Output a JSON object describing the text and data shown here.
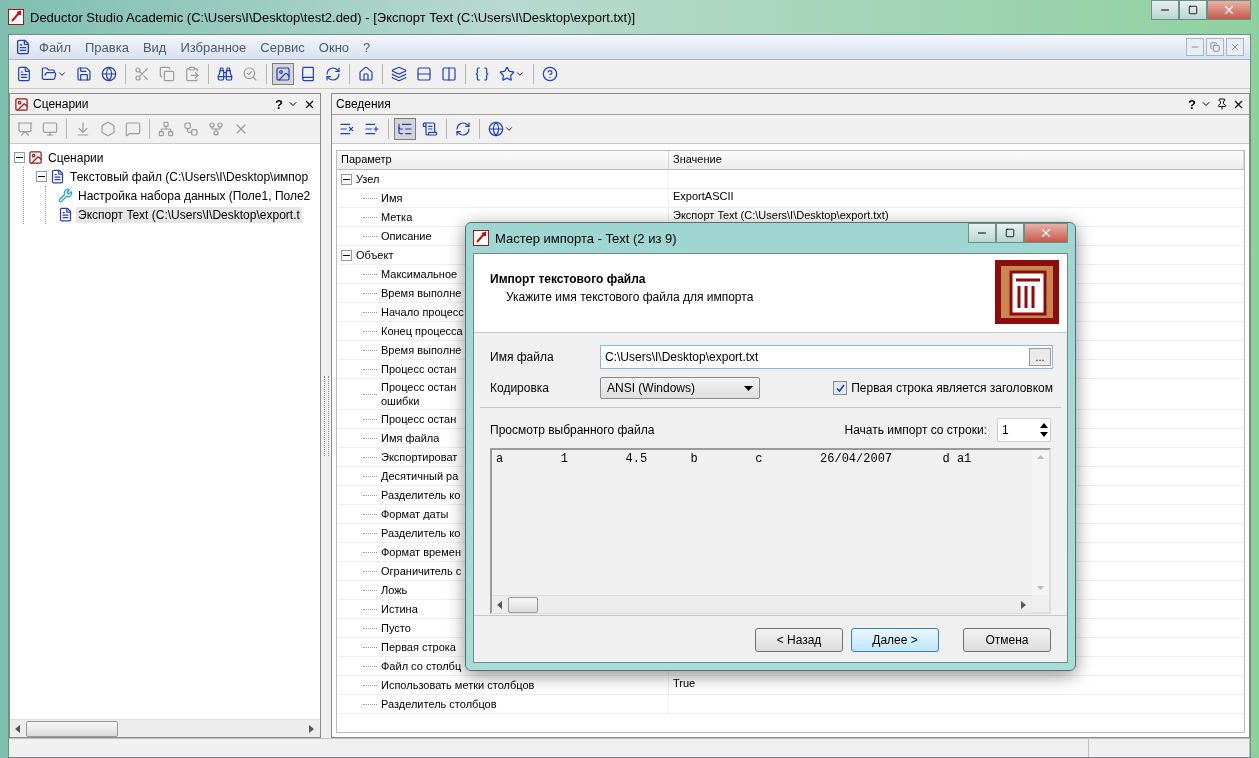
{
  "window": {
    "title": "Deductor Studio Academic (C:\\Users\\I\\Desktop\\test2.ded) - [Экспорт Text (C:\\Users\\I\\Desktop\\export.txt)]"
  },
  "menu": [
    "Файл",
    "Правка",
    "Вид",
    "Избранное",
    "Сервис",
    "Окно",
    "?"
  ],
  "toolbar": [
    {
      "pressed": false,
      "disabled": false
    },
    {
      "pressed": false,
      "disabled": false
    },
    {
      "pressed": false,
      "disabled": false
    },
    {
      "pressed": false,
      "disabled": false
    },
    {
      "pressed": false,
      "disabled": true
    },
    {
      "pressed": false,
      "disabled": true
    },
    {
      "pressed": false,
      "disabled": true
    },
    {
      "pressed": false,
      "disabled": false
    },
    {
      "pressed": false,
      "disabled": true
    },
    {
      "pressed": true,
      "disabled": false
    },
    {
      "pressed": false,
      "disabled": false
    },
    {
      "pressed": false,
      "disabled": false
    },
    {
      "pressed": false,
      "disabled": false
    },
    {
      "pressed": false,
      "disabled": false
    },
    {
      "pressed": false,
      "disabled": false
    },
    {
      "pressed": false,
      "disabled": false
    },
    {
      "pressed": false,
      "disabled": false
    },
    {
      "pressed": false,
      "disabled": false
    },
    {
      "pressed": false,
      "disabled": false
    }
  ],
  "scenarios_panel": {
    "title": "Сценарии",
    "help": "?",
    "toolbar": [
      {
        "disabled": true
      },
      {
        "disabled": true
      },
      {
        "disabled": true
      },
      {
        "disabled": true
      },
      {
        "disabled": true
      },
      {
        "disabled": true
      },
      {
        "disabled": true
      },
      {
        "disabled": true
      },
      {
        "disabled": true
      }
    ],
    "tree": [
      {
        "label": "Сценарии",
        "expanded": true,
        "selected": false,
        "children": [
          {
            "label": "Текстовый файл (C:\\Users\\I\\Desktop\\импор",
            "expanded": true,
            "selected": false,
            "children": [
              {
                "label": "Настройка набора данных (Поле1, Поле2",
                "selected": false
              },
              {
                "label": "Экспорт Text (C:\\Users\\I\\Desktop\\export.t",
                "selected": true
              }
            ]
          }
        ]
      }
    ]
  },
  "info_panel": {
    "title": "Сведения",
    "help": "?",
    "toolbar": [
      {
        "pressed": false
      },
      {
        "pressed": false
      },
      {
        "pressed": true
      },
      {
        "pressed": false
      },
      {
        "pressed": false
      },
      {
        "pressed": false
      }
    ],
    "columns": [
      "Параметр",
      "Значение"
    ],
    "groups": [
      {
        "label": "Узел",
        "expanded": true,
        "rows": [
          {
            "name": "Имя",
            "value": "ExportASCII"
          },
          {
            "name": "Метка",
            "value": "Экспорт Text (C:\\Users\\I\\Desktop\\export.txt)"
          },
          {
            "name": "Описание"
          }
        ]
      },
      {
        "label": "Объект",
        "expanded": true,
        "rows": [
          {
            "name": "Максимальное"
          },
          {
            "name": "Время выполне"
          },
          {
            "name": "Начало процесс"
          },
          {
            "name": "Конец процесса"
          },
          {
            "name": "Время выполне"
          },
          {
            "name": "Процесс остан"
          },
          {
            "name": "Процесс остан\nошибки"
          },
          {
            "name": "Процесс остан"
          },
          {
            "name": "Имя файла"
          },
          {
            "name": "Экспортироват"
          },
          {
            "name": "Десятичный ра"
          },
          {
            "name": "Разделитель ко"
          },
          {
            "name": "Формат даты"
          },
          {
            "name": "Разделитель ко"
          },
          {
            "name": "Формат времен"
          },
          {
            "name": "Ограничитель с"
          },
          {
            "name": "Ложь"
          },
          {
            "name": "Истина"
          },
          {
            "name": "Пусто"
          },
          {
            "name": "Первая строка"
          },
          {
            "name": "Файл со столбц"
          },
          {
            "name": "Использовать метки столбцов",
            "value": "True"
          },
          {
            "name": "Разделитель столбцов"
          }
        ]
      }
    ]
  },
  "dialog": {
    "title": "Мастер импорта - Text (2 из 9)",
    "heading": "Импорт текстового файла",
    "subheading": "Укажите имя текстового файла для импорта",
    "file_label": "Имя файла",
    "file_value": "C:\\Users\\I\\Desktop\\export.txt",
    "browse": "...",
    "encoding_label": "Кодировка",
    "encoding_value": "ANSI (Windows)",
    "header_checkbox": {
      "label": "Первая строка является заголовком",
      "checked": true
    },
    "preview_label": "Просмотр выбранного файла",
    "start_label": "Начать импорт со строки:",
    "start_value": "1",
    "preview_lines": [
      "a        1        4.5      b        c        26/04/2007       d a1"
    ],
    "buttons": [
      {
        "label": "< Назад",
        "default": false
      },
      {
        "label": "Далее >",
        "default": true
      },
      {
        "label": "Отмена",
        "default": false
      }
    ]
  }
}
